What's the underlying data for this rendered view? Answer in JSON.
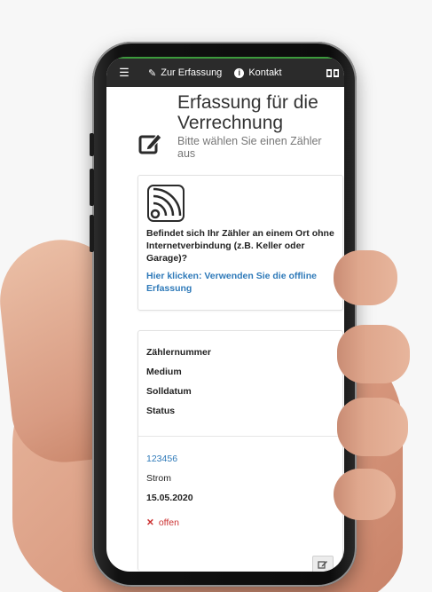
{
  "navbar": {
    "menu_icon": "hamburger-icon",
    "item1_icon": "pencil-icon",
    "item1_label": "Zur Erfassung",
    "item2_icon": "info-icon",
    "item2_label": "Kontakt",
    "lang_icon": "language-flag-icon"
  },
  "header": {
    "icon": "edit-square-icon",
    "title": "Erfassung für die Verrechnung",
    "subtitle": "Bitte wählen Sie einen Zähler aus"
  },
  "offline_card": {
    "icon": "rss-signal-icon",
    "text": "Befindet sich Ihr Zähler an einem Ort ohne Internetverbindung (z.B. Keller oder Garage)?",
    "link": "Hier klicken: Verwenden Sie die offline Erfassung"
  },
  "meter_table": {
    "headers": [
      "Zählernummer",
      "Medium",
      "Solldatum",
      "Status"
    ],
    "row": {
      "number": "123456",
      "medium": "Strom",
      "date": "15.05.2020",
      "status": "offen",
      "status_icon": "x-icon",
      "edit_icon": "edit-icon"
    }
  },
  "colors": {
    "navbar_bg": "#2b2b2b",
    "link": "#2f7ab9",
    "status_open": "#cc3333"
  }
}
